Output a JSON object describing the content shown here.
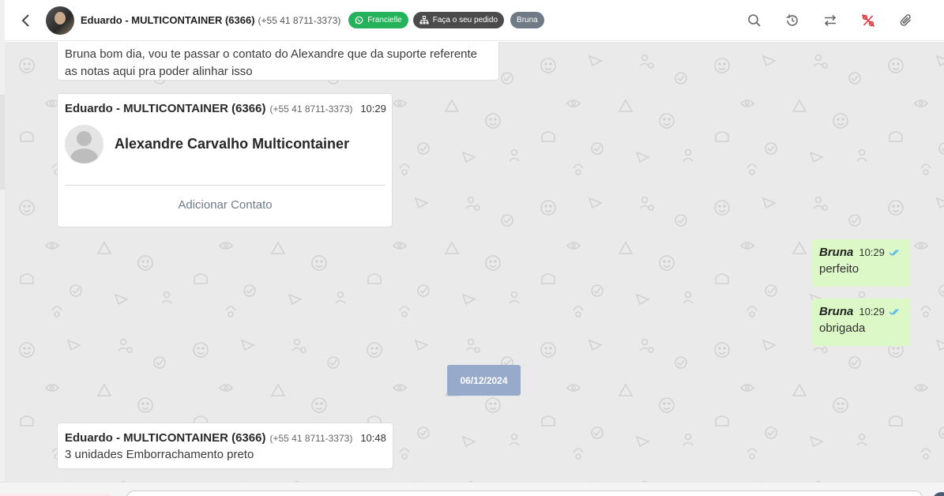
{
  "header": {
    "contact_name": "Eduardo - MULTICONTAINER (6366)",
    "contact_phone": "(+55 41 8711-3373)",
    "badges": {
      "channel": "Francielle",
      "order": "Faça o seu pedido",
      "agent": "Bruna"
    },
    "colors": {
      "channel": "#24b35a",
      "order": "#4b4b4b",
      "agent": "#6f7a86",
      "danger_icon": "#e0343a"
    },
    "actions": [
      "search-icon",
      "history-icon",
      "transfer-icon",
      "no-percent-icon",
      "paperclip-icon"
    ]
  },
  "messages": {
    "top_text": "Bruna bom dia, vou te passar o contato do Alexandre que da suporte referente as notas aqui pra poder alinhar isso",
    "contact_card": {
      "sender": "Eduardo - MULTICONTAINER (6366)",
      "phone": "(+55 41 8711-3373)",
      "time": "10:29",
      "shared_contact_name": "Alexandre Carvalho Multicontainer",
      "action_label": "Adicionar Contato"
    },
    "outgoing": [
      {
        "sender": "Bruna",
        "time": "10:29",
        "text": "perfeito"
      },
      {
        "sender": "Bruna",
        "time": "10:29",
        "text": "obrigada"
      }
    ],
    "date_divider": "06/12/2024",
    "last_incoming": {
      "sender": "Eduardo - MULTICONTAINER (6366)",
      "phone": "(+55 41 8711-3373)",
      "time": "10:48",
      "text": "3 unidades Emborrachamento preto"
    }
  },
  "theme": {
    "chat_background": "#eaeaea",
    "outgoing_bubble": "#dcf8c6",
    "date_pill": "#98aacb",
    "read_ticks": "#4fb6ec"
  }
}
